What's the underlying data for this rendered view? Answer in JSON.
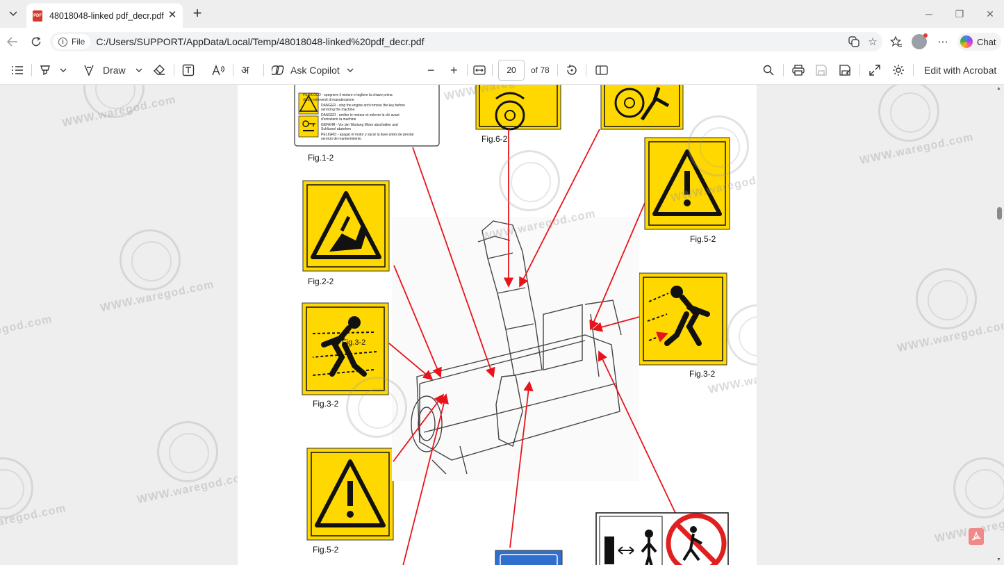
{
  "browser": {
    "tab_title": "48018048-linked pdf_decr.pdf",
    "file_label": "File",
    "url": "C:/Users/SUPPORT/AppData/Local/Temp/48018048-linked%20pdf_decr.pdf",
    "chat_label": "Chat"
  },
  "pdf_toolbar": {
    "draw_label": "Draw",
    "ask_copilot_label": "Ask Copilot",
    "current_page": "20",
    "page_total": "of 78",
    "edit_label": "Edit with Acrobat"
  },
  "document": {
    "fig_labels": {
      "f1": "Fig.1-2",
      "f6": "Fig.6-2",
      "f5a": "Fig.5-2",
      "f2": "Fig.2-2",
      "f3a": "Fig.3-2",
      "f3b": "Fig.3-2",
      "f3c": "Fig.3-2",
      "f5b": "Fig.5-2"
    },
    "decal_text": {
      "l1": "PERICOLO - spegnere il motore e togliere la chiave prima",
      "l2": "di fare interventi di manutenzione",
      "l3": "DANGER - stop the engine and remove the key before",
      "l4": "servicing the machine",
      "l5": "DANGER - arrêter le moteur et enlever la clé avant",
      "l6": "d'entretenir la machine",
      "l7": "GEFAHR - Vor der Wartung Motor abschalten und",
      "l8": "Schlüssel abziehen",
      "l9": "PELIGRO - apagar el motor y sacar la llave antes de prestar",
      "l10": "servicio de mantenimiento"
    },
    "watermark": "WWW.waregod.com",
    "colors": {
      "decal_yellow": "#ffd800",
      "arrow_red": "#e8141b",
      "prohibit_red": "#e02020",
      "sign_blue": "#2f6fd0"
    }
  }
}
